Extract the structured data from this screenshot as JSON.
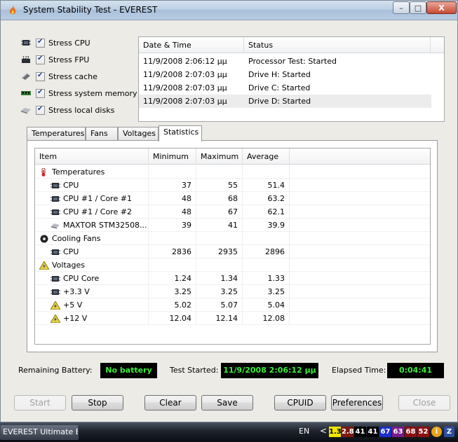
{
  "window": {
    "title": "System Stability Test - EVEREST",
    "buttons": {
      "minimize": "–",
      "maximize": "□",
      "close": "X"
    }
  },
  "stress_options": [
    {
      "label": "Stress CPU",
      "icon": "cpu-chip-icon",
      "checked": true
    },
    {
      "label": "Stress FPU",
      "icon": "fpu-123-icon",
      "checked": true
    },
    {
      "label": "Stress cache",
      "icon": "cache-module-icon",
      "checked": true
    },
    {
      "label": "Stress system memory",
      "icon": "memory-module-icon",
      "checked": true
    },
    {
      "label": "Stress local disks",
      "icon": "hard-disk-icon",
      "checked": true
    }
  ],
  "log": {
    "columns": [
      "Date & Time",
      "Status"
    ],
    "rows": [
      {
        "time": "11/9/2008 2:06:12 μμ",
        "status": "Processor Test: Started"
      },
      {
        "time": "11/9/2008 2:07:03 μμ",
        "status": "Drive H: Started"
      },
      {
        "time": "11/9/2008 2:07:03 μμ",
        "status": "Drive C: Started"
      },
      {
        "time": "11/9/2008 2:07:03 μμ",
        "status": "Drive D: Started"
      }
    ]
  },
  "tabs": [
    {
      "label": "Temperatures",
      "active": false
    },
    {
      "label": "Fans",
      "active": false
    },
    {
      "label": "Voltages",
      "active": false
    },
    {
      "label": "Statistics",
      "active": true
    }
  ],
  "stats": {
    "columns": [
      "Item",
      "Minimum",
      "Maximum",
      "Average"
    ],
    "rows": [
      {
        "kind": "group",
        "icon": "thermometer-icon",
        "item": "Temperatures"
      },
      {
        "kind": "data",
        "icon": "cpu-chip-icon",
        "item": "CPU",
        "min": "37",
        "max": "55",
        "avg": "51.4"
      },
      {
        "kind": "data",
        "icon": "cpu-chip-icon",
        "item": "CPU #1 / Core #1",
        "min": "48",
        "max": "68",
        "avg": "63.2"
      },
      {
        "kind": "data",
        "icon": "cpu-chip-icon",
        "item": "CPU #1 / Core #2",
        "min": "48",
        "max": "67",
        "avg": "62.1"
      },
      {
        "kind": "data",
        "icon": "hard-disk-icon",
        "item": "MAXTOR STM32508...",
        "min": "39",
        "max": "41",
        "avg": "39.9"
      },
      {
        "kind": "group",
        "icon": "fan-icon",
        "item": "Cooling Fans"
      },
      {
        "kind": "data",
        "icon": "cpu-chip-icon",
        "item": "CPU",
        "min": "2836",
        "max": "2935",
        "avg": "2896"
      },
      {
        "kind": "group",
        "icon": "voltage-icon",
        "item": "Voltages"
      },
      {
        "kind": "data",
        "icon": "cpu-chip-icon",
        "item": "CPU Core",
        "min": "1.24",
        "max": "1.34",
        "avg": "1.33"
      },
      {
        "kind": "data",
        "icon": "cpu-chip-icon",
        "item": "+3.3 V",
        "min": "3.25",
        "max": "3.25",
        "avg": "3.25"
      },
      {
        "kind": "data",
        "icon": "voltage-icon",
        "item": "+5 V",
        "min": "5.02",
        "max": "5.07",
        "avg": "5.04"
      },
      {
        "kind": "data",
        "icon": "voltage-icon",
        "item": "+12 V",
        "min": "12.04",
        "max": "12.14",
        "avg": "12.08"
      }
    ]
  },
  "status": {
    "battery_label": "Remaining Battery:",
    "battery_value": "No battery",
    "test_started_label": "Test Started:",
    "test_started_value": "11/9/2008 2:06:12 μμ",
    "elapsed_label": "Elapsed Time:",
    "elapsed_value": "0:04:41",
    "value_color": "#39f039"
  },
  "buttons": {
    "start": "Start",
    "stop": "Stop",
    "clear": "Clear",
    "save": "Save",
    "cpuid": "CPUID",
    "preferences": "Preferences",
    "close": "Close"
  },
  "taskbar": {
    "task_label": "EVEREST Ultimate E...",
    "language": "EN",
    "tray_arrow": "<",
    "tray_values": [
      {
        "text": "1.3",
        "bg": "#f2e600",
        "fg": "#000000"
      },
      {
        "text": "2.8",
        "bg": "#7a1a10",
        "fg": "#ffffff"
      },
      {
        "text": "41",
        "bg": "#000000",
        "fg": "#ffffff"
      },
      {
        "text": "41",
        "bg": "#000000",
        "fg": "#ffffff"
      },
      {
        "text": "67",
        "bg": "#1a2ec8",
        "fg": "#ffffff"
      },
      {
        "text": "63",
        "bg": "#7a1a8e",
        "fg": "#ffffff"
      },
      {
        "text": "68",
        "bg": "#8a1010",
        "fg": "#ffffff"
      },
      {
        "text": "52",
        "bg": "#8a1010",
        "fg": "#ffffff"
      }
    ],
    "tray_icons": [
      "info-icon",
      "z-app-icon"
    ]
  }
}
